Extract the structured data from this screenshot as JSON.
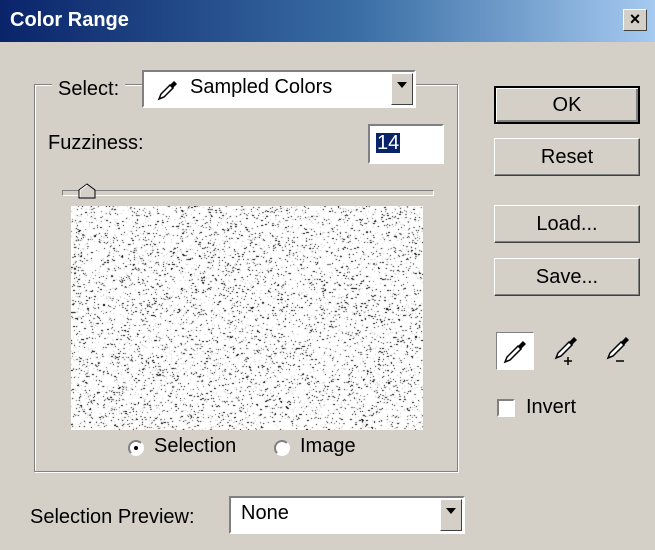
{
  "window": {
    "title": "Color Range",
    "close_glyph": "×"
  },
  "select": {
    "label": "Select:",
    "value": "Sampled Colors",
    "icon": "eyedropper-icon"
  },
  "fuzziness": {
    "label": "Fuzziness:",
    "value": "14",
    "slider_level": 0.07
  },
  "preview_mode": {
    "selection_label": "Selection",
    "image_label": "Image",
    "selected": "selection"
  },
  "selection_preview": {
    "label": "Selection Preview:",
    "value": "None"
  },
  "buttons": {
    "ok": "OK",
    "reset": "Reset",
    "load": "Load...",
    "save": "Save..."
  },
  "tools": [
    "eyedropper-icon",
    "eyedropper-plus-icon",
    "eyedropper-minus-icon"
  ],
  "invert": {
    "label": "Invert",
    "checked": false
  }
}
